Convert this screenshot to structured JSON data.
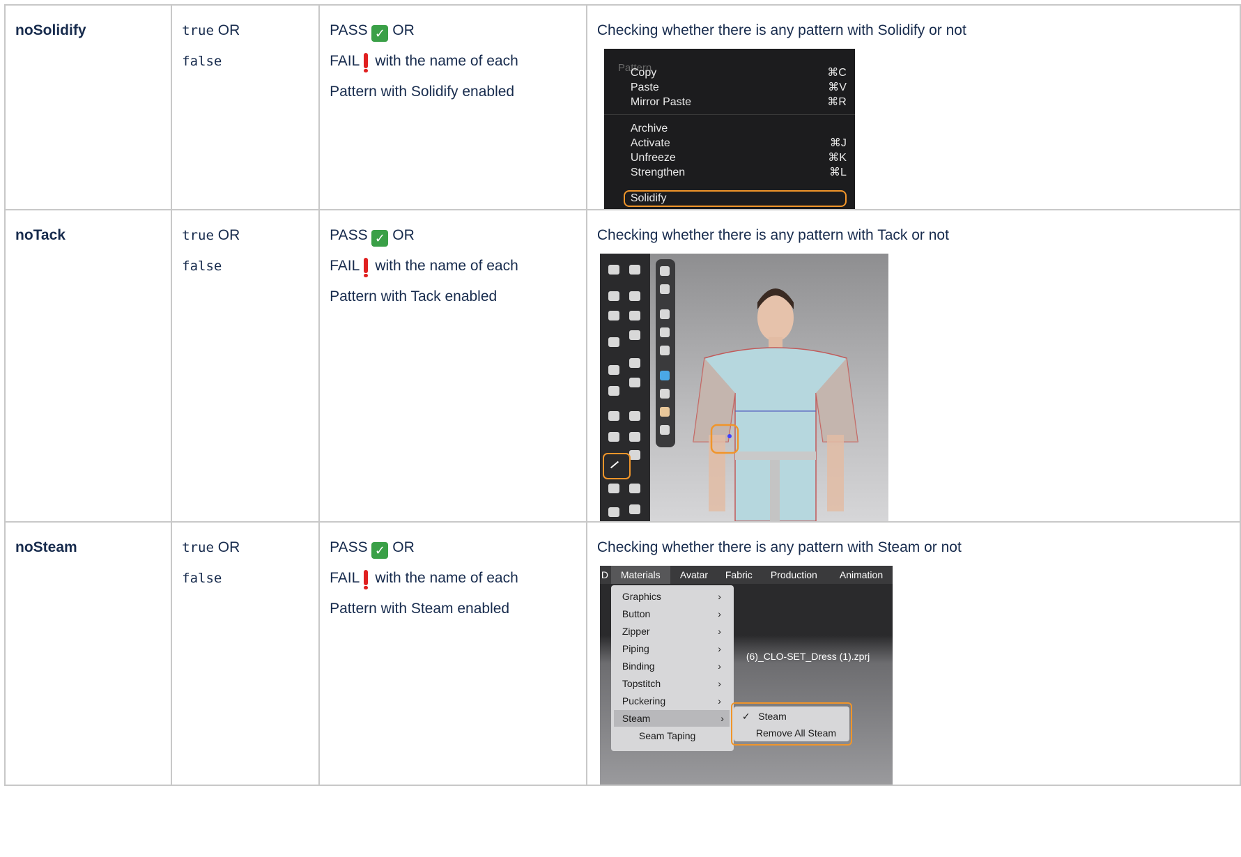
{
  "rows": [
    {
      "name": "noSolidify",
      "values_mono1": "true",
      "values_or": "OR",
      "values_mono2": "false",
      "pass": "PASS",
      "or": "OR",
      "fail": "FAIL",
      "fail_text": "with the name of each",
      "fail_text2": "Pattern with Solidify enabled",
      "description": "Checking whether there is any pattern with Solidify or not"
    },
    {
      "name": "noTack",
      "values_mono1": "true",
      "values_or": "OR",
      "values_mono2": "false",
      "pass": "PASS",
      "or": "OR",
      "fail": "FAIL",
      "fail_text": "with the name of each",
      "fail_text2": "Pattern with Tack enabled",
      "description": "Checking whether there is any pattern with Tack or not"
    },
    {
      "name": "noSteam",
      "values_mono1": "true",
      "values_or": "OR",
      "values_mono2": "false",
      "pass": "PASS",
      "or": "OR",
      "fail": "FAIL",
      "fail_text": "with the name of each",
      "fail_text2": "Pattern with Steam enabled",
      "description": "Checking whether there is any pattern with Steam or not"
    }
  ],
  "icons": {
    "pass": "check-mark-icon",
    "fail": "exclamation-icon",
    "pass_color": "#3aa047",
    "fail_color": "#e02020",
    "highlight_color": "#f0952a"
  },
  "menu1": {
    "header": "Pattern",
    "items": [
      {
        "label": "Copy",
        "key": "⌘C"
      },
      {
        "label": "Paste",
        "key": "⌘V"
      },
      {
        "label": "Mirror Paste",
        "key": "⌘R"
      },
      {
        "label": "Archive",
        "key": ""
      },
      {
        "label": "Activate",
        "key": "⌘J"
      },
      {
        "label": "Unfreeze",
        "key": "⌘K"
      },
      {
        "label": "Strengthen",
        "key": "⌘L"
      },
      {
        "label": "Solidify",
        "key": ""
      }
    ]
  },
  "menu3": {
    "menubar": [
      "Materials",
      "Avatar",
      "Fabric",
      "Production",
      "Animation"
    ],
    "items": [
      "Graphics",
      "Button",
      "Zipper",
      "Piping",
      "Binding",
      "Topstitch",
      "Puckering",
      "Steam",
      "Seam Taping"
    ],
    "submenu": [
      "Steam",
      "Remove All Steam"
    ],
    "filename": "(6)_CLO-SET_Dress (1).zprj",
    "checkmark": "✓",
    "chevron": "›",
    "menubar_prefix": "D"
  }
}
